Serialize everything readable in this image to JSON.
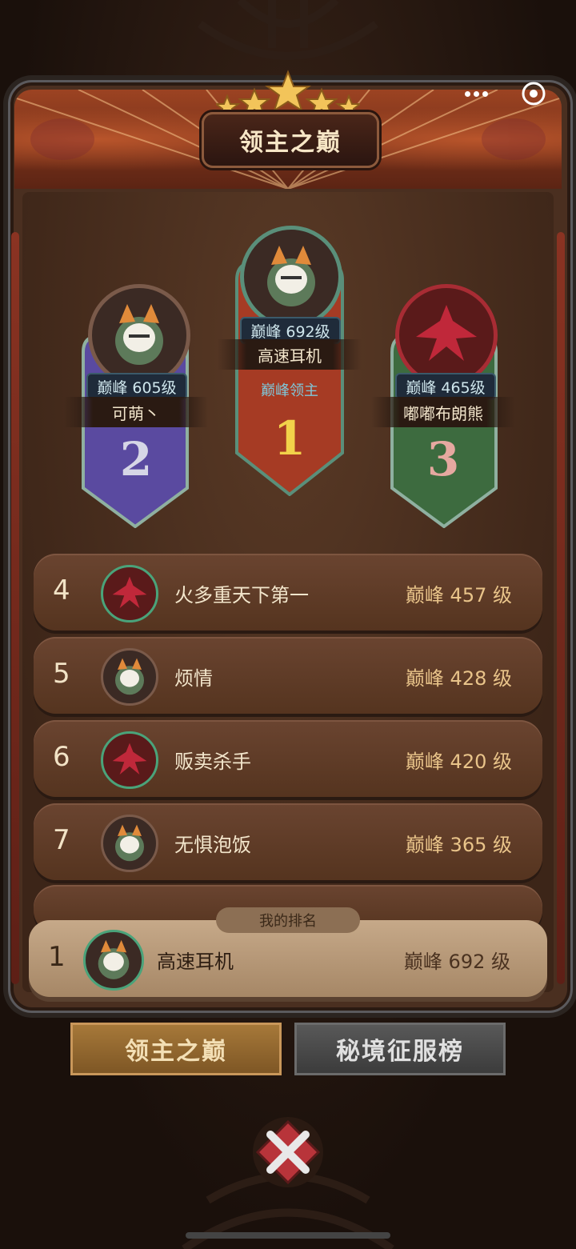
{
  "header": {
    "title": "领主之巅",
    "menu_icon": "more-dots-icon",
    "close_icon": "target-close-icon"
  },
  "podium": {
    "first": {
      "rank": "1",
      "name": "高速耳机",
      "level": "巅峰 692级",
      "subtitle": "巅峰领主",
      "avatar": "fox-hero-avatar"
    },
    "second": {
      "rank": "2",
      "name": "可萌丶",
      "level": "巅峰 605级",
      "avatar": "fox-hero-avatar"
    },
    "third": {
      "rank": "3",
      "name": "嘟嘟布朗熊",
      "level": "巅峰 465级",
      "avatar": "red-dragon-avatar"
    }
  },
  "rows": [
    {
      "rank": "4",
      "name": "火多重天下第一",
      "level": "巅峰 457 级",
      "avatar": "red-dragon-avatar"
    },
    {
      "rank": "5",
      "name": "烦情",
      "level": "巅峰 428 级",
      "avatar": "fox-hero-avatar"
    },
    {
      "rank": "6",
      "name": "贩卖杀手",
      "level": "巅峰 420 级",
      "avatar": "red-dragon-avatar"
    },
    {
      "rank": "7",
      "name": "无惧泡饭",
      "level": "巅峰 365 级",
      "avatar": "fox-hero-avatar"
    }
  ],
  "my_rank": {
    "label": "我的排名",
    "rank": "1",
    "name": "高速耳机",
    "level": "巅峰 692 级"
  },
  "tabs": {
    "active": "领主之巅",
    "inactive": "秘境征服榜"
  },
  "colors": {
    "banner_first": "#a63b24",
    "banner_second": "#5a4aa0",
    "banner_third": "#3d6b3f",
    "tab_active": "#a87a3a"
  }
}
